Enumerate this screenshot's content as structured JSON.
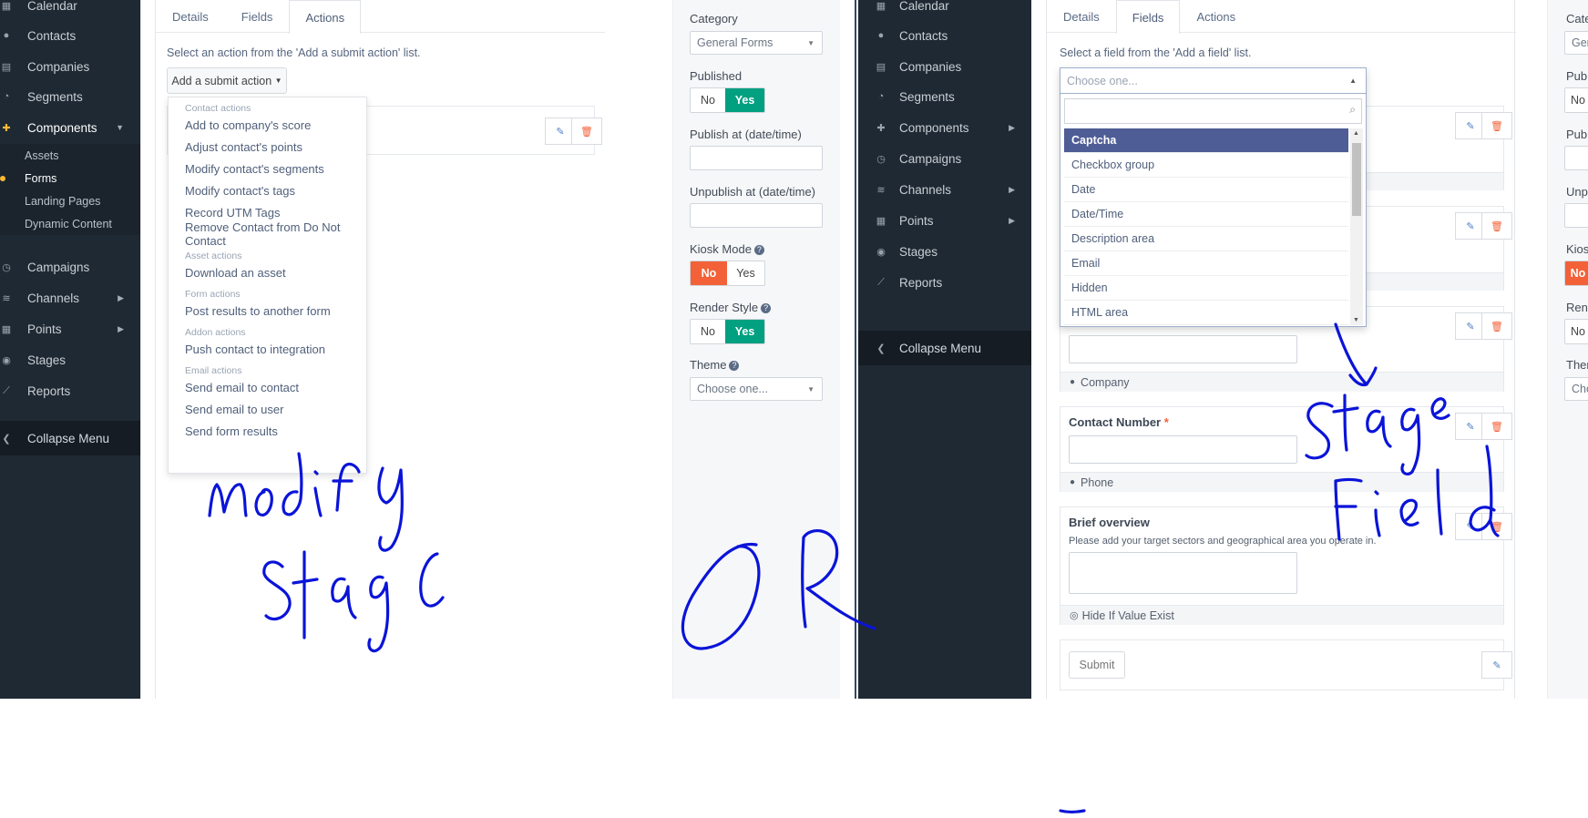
{
  "left": {
    "sidebar": {
      "items": [
        {
          "label": "Calendar",
          "icon": "calendar-icon"
        },
        {
          "label": "Contacts",
          "icon": "user-icon"
        },
        {
          "label": "Companies",
          "icon": "building-icon"
        },
        {
          "label": "Segments",
          "icon": "pie-chart-icon"
        },
        {
          "label": "Components",
          "icon": "puzzle-icon"
        }
      ],
      "sub_items": [
        "Assets",
        "Forms",
        "Landing Pages",
        "Dynamic Content"
      ],
      "items_after": [
        {
          "label": "Campaigns",
          "icon": "clock-icon"
        },
        {
          "label": "Channels",
          "icon": "rss-icon"
        },
        {
          "label": "Points",
          "icon": "calculator-icon"
        },
        {
          "label": "Stages",
          "icon": "tachometer-icon"
        },
        {
          "label": "Reports",
          "icon": "line-chart-icon"
        }
      ],
      "collapse": "Collapse Menu"
    },
    "tabs": [
      "Details",
      "Fields",
      "Actions"
    ],
    "hint": "Select an action from the 'Add a submit action' list.",
    "add_button": "Add a submit action",
    "dropdown": {
      "contact_header": "Contact actions",
      "contact_items": [
        "Add to company's score",
        "Adjust contact's points",
        "Modify contact's segments",
        "Modify contact's tags",
        "Record UTM Tags",
        "Remove Contact from Do Not Contact"
      ],
      "asset_header": "Asset actions",
      "asset_items": [
        "Download an asset"
      ],
      "form_header": "Form actions",
      "form_items": [
        "Post results to another form"
      ],
      "addon_header": "Addon actions",
      "addon_items": [
        "Push contact to integration"
      ],
      "email_header": "Email actions",
      "email_items": [
        "Send email to contact",
        "Send email to user",
        "Send form results"
      ]
    },
    "right": {
      "category_label": "Category",
      "category_value": "General Forms",
      "published_label": "Published",
      "no": "No",
      "yes": "Yes",
      "publish_at_label": "Publish at (date/time)",
      "unpublish_at_label": "Unpublish at (date/time)",
      "kiosk_label": "Kiosk Mode",
      "render_label": "Render Style",
      "theme_label": "Theme",
      "theme_placeholder": "Choose one..."
    }
  },
  "middle": {
    "sidebar": {
      "items": [
        {
          "label": "Calendar"
        },
        {
          "label": "Contacts"
        },
        {
          "label": "Companies"
        },
        {
          "label": "Segments"
        },
        {
          "label": "Components"
        },
        {
          "label": "Campaigns"
        },
        {
          "label": "Channels"
        },
        {
          "label": "Points"
        },
        {
          "label": "Stages"
        },
        {
          "label": "Reports"
        }
      ],
      "collapse": "Collapse Menu"
    },
    "tabs": [
      "Details",
      "Fields",
      "Actions"
    ],
    "hint": "Select a field from the 'Add a field' list.",
    "combo_placeholder": "Choose one...",
    "options": [
      "Captcha",
      "Checkbox group",
      "Date",
      "Date/Time",
      "Description area",
      "Email",
      "Hidden",
      "HTML area"
    ],
    "cards": {
      "company_foot": "Company",
      "contact_title": "Contact Number",
      "contact_foot": "Phone",
      "brief_title": "Brief overview",
      "brief_help": "Please add your target sectors and geographical area you operate in.",
      "brief_foot": "Hide If Value Exist",
      "submit": "Submit"
    }
  },
  "right_partial": {
    "labels": [
      "Cate",
      "Gen",
      "Publ",
      "No",
      "Publ",
      "Unpu",
      "Kios",
      "No",
      "Rend",
      "No",
      "Ther",
      "Cho"
    ]
  },
  "annotations": {
    "text1": "modify",
    "text2": "stage",
    "text3": "OR",
    "text4": "stage",
    "text5": "Field"
  },
  "colors": {
    "sidebar_bg": "#1f2933",
    "accent_yes": "#00a080",
    "accent_no": "#f26138",
    "ink": "#0a14d8"
  }
}
